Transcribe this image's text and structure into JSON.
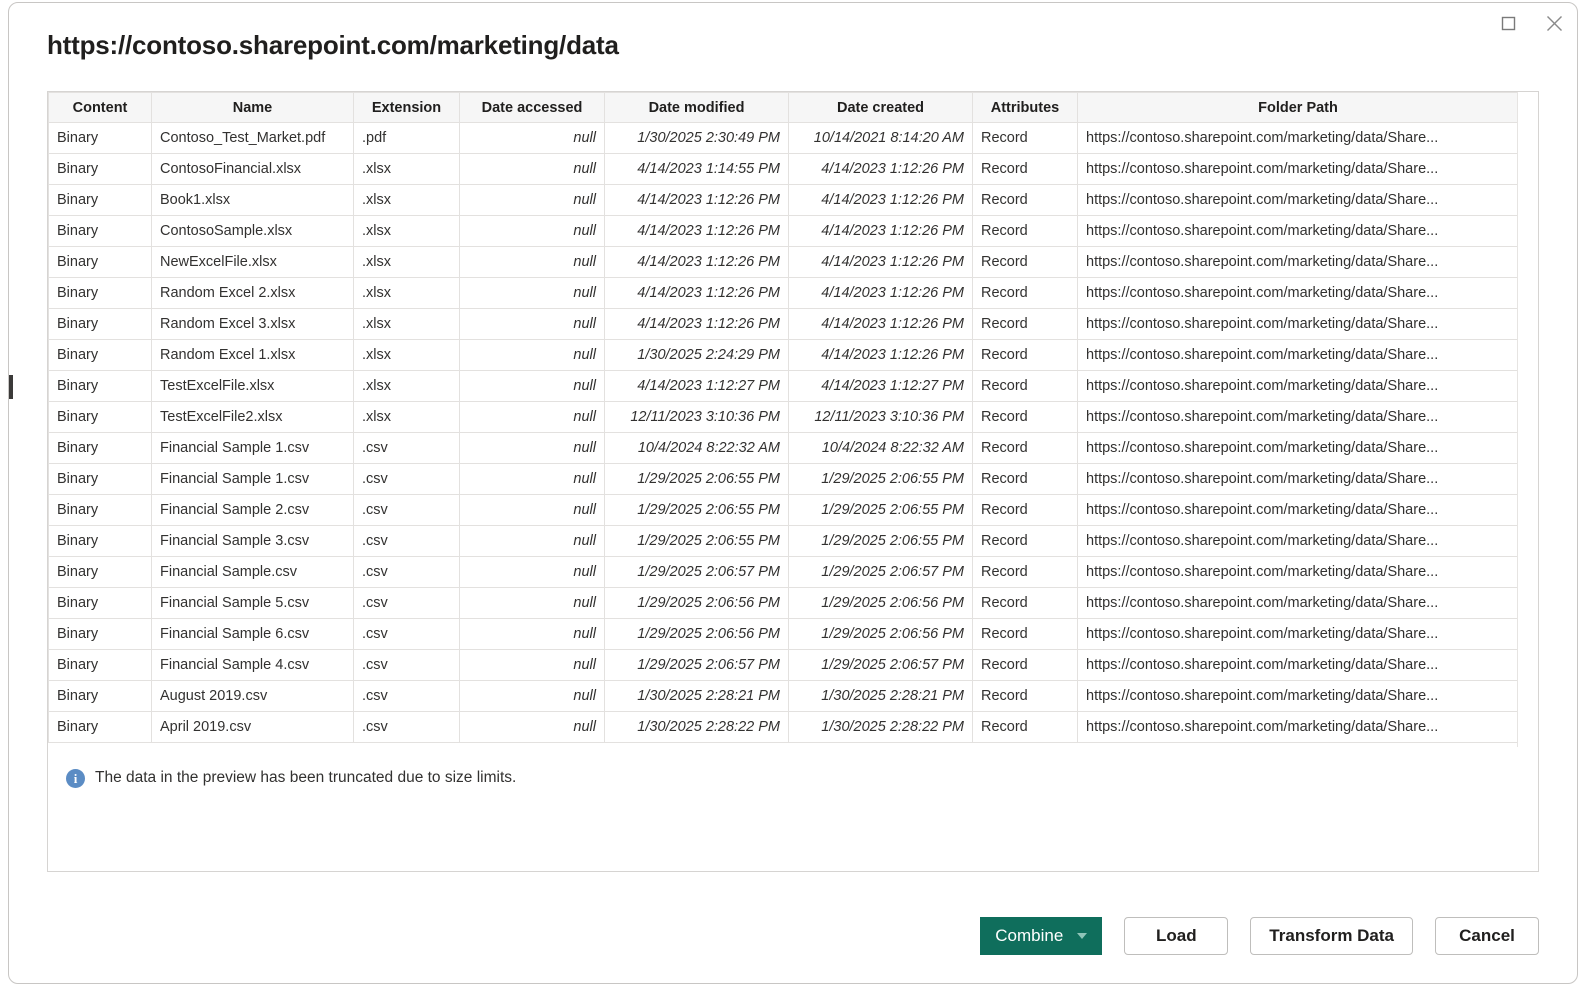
{
  "window": {
    "restore_icon": "restore-window-icon",
    "close_icon": "close-icon"
  },
  "dialog": {
    "title": "https://contoso.sharepoint.com/marketing/data"
  },
  "table": {
    "columns": [
      "Content",
      "Name",
      "Extension",
      "Date accessed",
      "Date modified",
      "Date created",
      "Attributes",
      "Folder Path"
    ],
    "rows": [
      [
        "Binary",
        "Contoso_Test_Market.pdf",
        ".pdf",
        "null",
        "1/30/2025 2:30:49 PM",
        "10/14/2021 8:14:20 AM",
        "Record",
        "https://contoso.sharepoint.com/marketing/data/Share..."
      ],
      [
        "Binary",
        "ContosoFinancial.xlsx",
        ".xlsx",
        "null",
        "4/14/2023 1:14:55 PM",
        "4/14/2023 1:12:26 PM",
        "Record",
        "https://contoso.sharepoint.com/marketing/data/Share..."
      ],
      [
        "Binary",
        "Book1.xlsx",
        ".xlsx",
        "null",
        "4/14/2023 1:12:26 PM",
        "4/14/2023 1:12:26 PM",
        "Record",
        "https://contoso.sharepoint.com/marketing/data/Share..."
      ],
      [
        "Binary",
        "ContosoSample.xlsx",
        ".xlsx",
        "null",
        "4/14/2023 1:12:26 PM",
        "4/14/2023 1:12:26 PM",
        "Record",
        "https://contoso.sharepoint.com/marketing/data/Share..."
      ],
      [
        "Binary",
        "NewExcelFile.xlsx",
        ".xlsx",
        "null",
        "4/14/2023 1:12:26 PM",
        "4/14/2023 1:12:26 PM",
        "Record",
        "https://contoso.sharepoint.com/marketing/data/Share..."
      ],
      [
        "Binary",
        "Random Excel 2.xlsx",
        ".xlsx",
        "null",
        "4/14/2023 1:12:26 PM",
        "4/14/2023 1:12:26 PM",
        "Record",
        "https://contoso.sharepoint.com/marketing/data/Share..."
      ],
      [
        "Binary",
        "Random Excel 3.xlsx",
        ".xlsx",
        "null",
        "4/14/2023 1:12:26 PM",
        "4/14/2023 1:12:26 PM",
        "Record",
        "https://contoso.sharepoint.com/marketing/data/Share..."
      ],
      [
        "Binary",
        "Random Excel 1.xlsx",
        ".xlsx",
        "null",
        "1/30/2025 2:24:29 PM",
        "4/14/2023 1:12:26 PM",
        "Record",
        "https://contoso.sharepoint.com/marketing/data/Share..."
      ],
      [
        "Binary",
        "TestExcelFile.xlsx",
        ".xlsx",
        "null",
        "4/14/2023 1:12:27 PM",
        "4/14/2023 1:12:27 PM",
        "Record",
        "https://contoso.sharepoint.com/marketing/data/Share..."
      ],
      [
        "Binary",
        "TestExcelFile2.xlsx",
        ".xlsx",
        "null",
        "12/11/2023 3:10:36 PM",
        "12/11/2023 3:10:36 PM",
        "Record",
        "https://contoso.sharepoint.com/marketing/data/Share..."
      ],
      [
        "Binary",
        "Financial Sample 1.csv",
        ".csv",
        "null",
        "10/4/2024 8:22:32 AM",
        "10/4/2024 8:22:32 AM",
        "Record",
        "https://contoso.sharepoint.com/marketing/data/Share..."
      ],
      [
        "Binary",
        "Financial Sample 1.csv",
        ".csv",
        "null",
        "1/29/2025 2:06:55 PM",
        "1/29/2025 2:06:55 PM",
        "Record",
        "https://contoso.sharepoint.com/marketing/data/Share..."
      ],
      [
        "Binary",
        "Financial Sample 2.csv",
        ".csv",
        "null",
        "1/29/2025 2:06:55 PM",
        "1/29/2025 2:06:55 PM",
        "Record",
        "https://contoso.sharepoint.com/marketing/data/Share..."
      ],
      [
        "Binary",
        "Financial Sample 3.csv",
        ".csv",
        "null",
        "1/29/2025 2:06:55 PM",
        "1/29/2025 2:06:55 PM",
        "Record",
        "https://contoso.sharepoint.com/marketing/data/Share..."
      ],
      [
        "Binary",
        "Financial Sample.csv",
        ".csv",
        "null",
        "1/29/2025 2:06:57 PM",
        "1/29/2025 2:06:57 PM",
        "Record",
        "https://contoso.sharepoint.com/marketing/data/Share..."
      ],
      [
        "Binary",
        "Financial Sample 5.csv",
        ".csv",
        "null",
        "1/29/2025 2:06:56 PM",
        "1/29/2025 2:06:56 PM",
        "Record",
        "https://contoso.sharepoint.com/marketing/data/Share..."
      ],
      [
        "Binary",
        "Financial Sample 6.csv",
        ".csv",
        "null",
        "1/29/2025 2:06:56 PM",
        "1/29/2025 2:06:56 PM",
        "Record",
        "https://contoso.sharepoint.com/marketing/data/Share..."
      ],
      [
        "Binary",
        "Financial Sample 4.csv",
        ".csv",
        "null",
        "1/29/2025 2:06:57 PM",
        "1/29/2025 2:06:57 PM",
        "Record",
        "https://contoso.sharepoint.com/marketing/data/Share..."
      ],
      [
        "Binary",
        "August 2019.csv",
        ".csv",
        "null",
        "1/30/2025 2:28:21 PM",
        "1/30/2025 2:28:21 PM",
        "Record",
        "https://contoso.sharepoint.com/marketing/data/Share..."
      ],
      [
        "Binary",
        "April 2019.csv",
        ".csv",
        "null",
        "1/30/2025 2:28:22 PM",
        "1/30/2025 2:28:22 PM",
        "Record",
        "https://contoso.sharepoint.com/marketing/data/Share..."
      ]
    ]
  },
  "info": {
    "icon": "info-icon",
    "glyph": "i",
    "message": "The data in the preview has been truncated due to size limits."
  },
  "footer": {
    "combine_label": "Combine",
    "load_label": "Load",
    "transform_label": "Transform Data",
    "cancel_label": "Cancel"
  },
  "colors": {
    "primary": "#0f6e5c",
    "info": "#5b8cc4",
    "text": "#323130",
    "header_bg": "#f6f6f6",
    "border": "#e3e1df"
  }
}
